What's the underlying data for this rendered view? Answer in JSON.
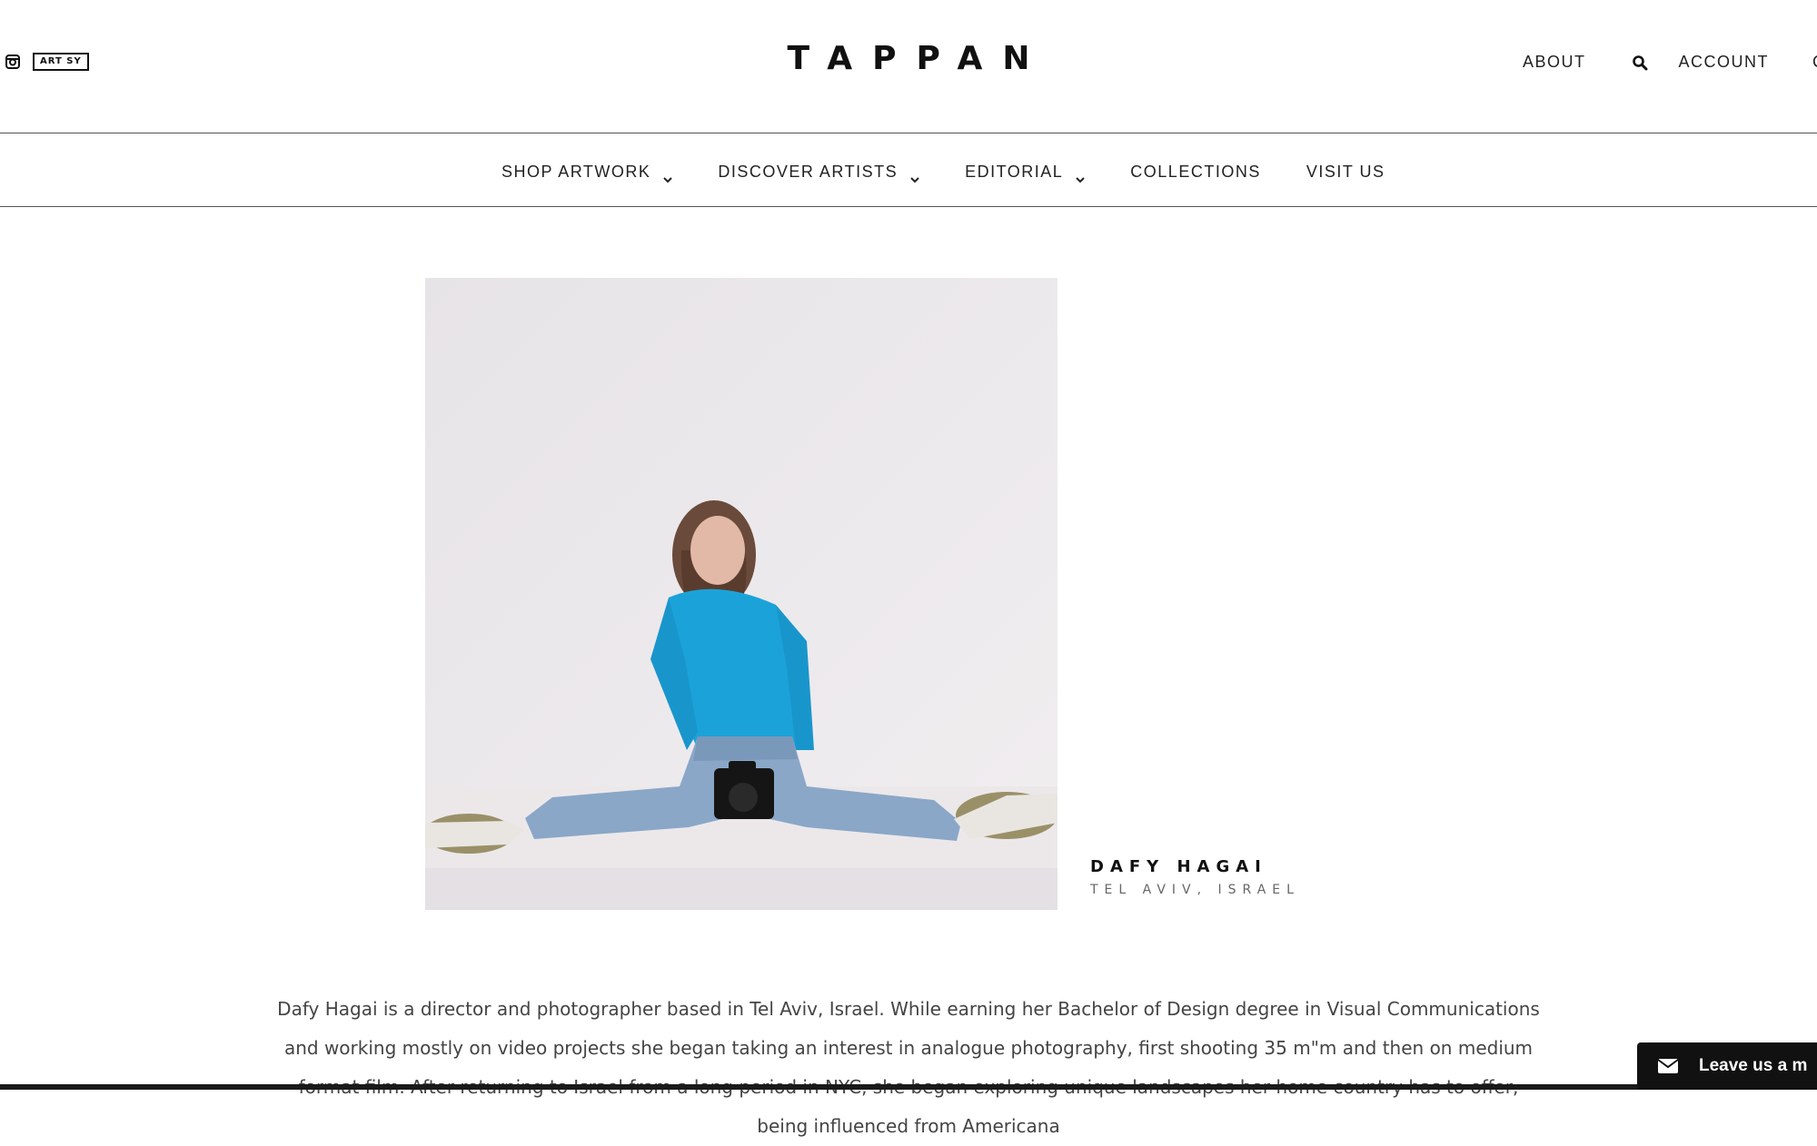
{
  "header": {
    "social": [
      {
        "icon": "instagram-icon"
      },
      {
        "label": "ART SY"
      }
    ],
    "brand": "TAPPAN",
    "right_links": {
      "about": "ABOUT",
      "account": "ACCOUNT",
      "cut": "C"
    }
  },
  "nav": {
    "items": [
      {
        "label": "SHOP ARTWORK",
        "has_dropdown": true
      },
      {
        "label": "DISCOVER ARTISTS",
        "has_dropdown": true
      },
      {
        "label": "EDITORIAL",
        "has_dropdown": true
      },
      {
        "label": "COLLECTIONS",
        "has_dropdown": false
      },
      {
        "label": "VISIT US",
        "has_dropdown": false
      }
    ]
  },
  "artist": {
    "name": "DAFY HAGAI",
    "location": "TEL AVIV, ISRAEL",
    "bio": "Dafy Hagai is a director and photographer based in Tel Aviv, Israel. While earning her Bachelor of Design degree in Visual Communications and working mostly on video projects she began taking an interest in analogue photography, first shooting 35 m\"m and then on medium format film. After returning to Israel from a long period in NYC, she began exploring unique landscapes her home country has to offer, being influenced from Americana"
  },
  "chat": {
    "label": "Leave us a m"
  },
  "colors": {
    "text": "#222222",
    "border": "#555555",
    "chat_bg": "#111111",
    "sweater": "#1ba3d9"
  }
}
